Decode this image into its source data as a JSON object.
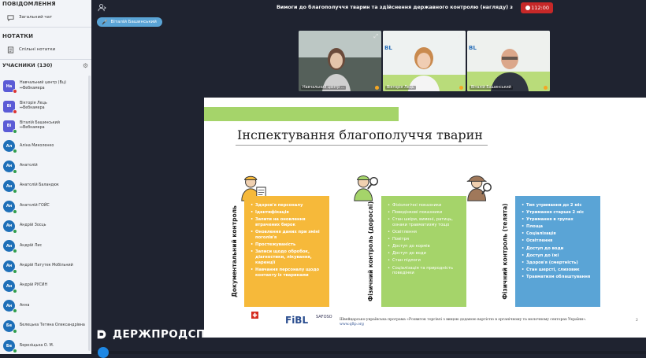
{
  "sidebar": {
    "messages_header": "ПОВІДОМЛЕННЯ",
    "public_chat": "Загальний чат",
    "notes_header": "НОТАТКИ",
    "shared_notes": "Спільні нотатки",
    "participants_header": "УЧАСНИКИ (130)",
    "participants": [
      {
        "initials": "На",
        "name": "Навчальний центр (Вц)",
        "sub": "↦Вебкамера",
        "color": "#5b5bd6",
        "square": true,
        "badge": "red"
      },
      {
        "initials": "Ві",
        "name": "Вікторія Лець",
        "sub": "↦Вебкамера",
        "color": "#5b5bd6",
        "square": true,
        "badge": "red"
      },
      {
        "initials": "Ві",
        "name": "Віталій Башинський",
        "sub": "↦Вебкамера",
        "color": "#5b5bd6",
        "square": true,
        "badge": "green"
      },
      {
        "initials": "Ал",
        "name": "Аліна Миколенко",
        "sub": "",
        "color": "#1e6fb8",
        "square": false,
        "badge": "green"
      },
      {
        "initials": "Ан",
        "name": "Анатолій",
        "sub": "",
        "color": "#1e6fb8",
        "square": false,
        "badge": "green"
      },
      {
        "initials": "Ан",
        "name": "Анатолій Баландюк",
        "sub": "",
        "color": "#1e6fb8",
        "square": false,
        "badge": "green"
      },
      {
        "initials": "Ан",
        "name": "Анатолій ГОЙС",
        "sub": "",
        "color": "#1e6fb8",
        "square": false,
        "badge": "green"
      },
      {
        "initials": "Ан",
        "name": "Андрій Зосць",
        "sub": "",
        "color": "#1e6fb8",
        "square": false,
        "badge": "green"
      },
      {
        "initials": "Ан",
        "name": "Андрій Лис",
        "sub": "",
        "color": "#1e6fb8",
        "square": false,
        "badge": "green"
      },
      {
        "initials": "Ан",
        "name": "Андрій Патутек Мобільний",
        "sub": "",
        "color": "#1e6fb8",
        "square": false,
        "badge": "green"
      },
      {
        "initials": "Ан",
        "name": "Андрій РУСИН",
        "sub": "",
        "color": "#1e6fb8",
        "square": false,
        "badge": "green"
      },
      {
        "initials": "Ан",
        "name": "Анна",
        "sub": "",
        "color": "#1e6fb8",
        "square": false,
        "badge": "green"
      },
      {
        "initials": "Бе",
        "name": "Белецька Тетяна Олександрівна",
        "sub": "",
        "color": "#1e6fb8",
        "square": false,
        "badge": "green"
      },
      {
        "initials": "Бе",
        "name": "Березіщька О. М.",
        "sub": "",
        "color": "#1e6fb8",
        "square": false,
        "badge": "green"
      }
    ]
  },
  "header": {
    "title": "Вимоги до благополуччя тварин та здійснення державного контролю (нагляду) за дотрима...",
    "recording_time": "112:00",
    "current_speaker": "Віталій Башинський"
  },
  "webcams": [
    {
      "label": "Навчальний центр ..."
    },
    {
      "label": "Вікторія Лець"
    },
    {
      "label": "Віталій Башинський"
    }
  ],
  "slide": {
    "title": "Інспектування благополуччя тварин",
    "columns": [
      {
        "label": "Документальний контроль",
        "items": [
          "Здоров'я персоналу",
          "Ідентифікація",
          "Запити на оновлення втрачених бирок",
          "Оновлення даних при зміні поголів'я",
          "Простежуваність",
          "Записи щодо обробок, діагностики, лікування, каренції",
          "Навчання персоналу щодо контакту із тваринами"
        ]
      },
      {
        "label": "Фізичний контроль (дорослі)",
        "items": [
          "Фізіологічні показники",
          "Поведінкові показники",
          "Стан шкіри, вимені, ратиць, ознаки травматизму тощо",
          "Освітлення",
          "Повітря",
          "Доступ до кормів",
          "Доступ до води",
          "Стан підлоги",
          "Соціалізація та природність поведінки"
        ]
      },
      {
        "label": "Фізичний контроль (телята)",
        "items": [
          "Тип утримання до 2 міс",
          "Утримання старше 2 міс",
          "Утримання в групах",
          "Площа",
          "Соціалізація",
          "Освітлення",
          "Доступ до води",
          "Доступ до їжі",
          "Здоров'я (смертність)",
          "Стан шерсті, слизовик",
          "Травматизм облаштування"
        ]
      }
    ],
    "footer": {
      "fibl": "FiBL",
      "safoso": "SAFOSO",
      "program_text": "Швейцарсько-українська програма «Розвиток торгівлі з вищою доданою вартістю в органічному та молочному секторах України».",
      "url": "www.qftp.org",
      "page": "2"
    }
  },
  "brand": {
    "text": "ДЕРЖПРОДСПОЖИВСЛУЖБА"
  },
  "colors": {
    "orange": "#f6b93a",
    "green": "#a5d46a",
    "blue": "#5aa4d6",
    "record": "#c62828"
  }
}
